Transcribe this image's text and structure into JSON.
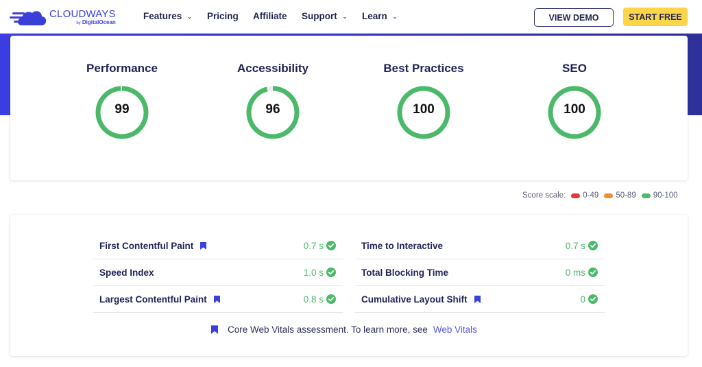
{
  "header": {
    "logo": {
      "name": "CLOUDWAYS",
      "by": "by",
      "sub": "DigitalOcean"
    },
    "nav": [
      {
        "label": "Features",
        "dropdown": true
      },
      {
        "label": "Pricing",
        "dropdown": false
      },
      {
        "label": "Affiliate",
        "dropdown": false
      },
      {
        "label": "Support",
        "dropdown": true
      },
      {
        "label": "Learn",
        "dropdown": true
      }
    ],
    "view_demo": "VIEW DEMO",
    "start_free": "START FREE"
  },
  "colors": {
    "brand": "#3a3fd9",
    "pass": "#4cb96a",
    "average": "#f08c36",
    "fail": "#e53935",
    "cta": "#fcd548"
  },
  "scores": [
    {
      "title": "Performance",
      "value": 99
    },
    {
      "title": "Accessibility",
      "value": 96
    },
    {
      "title": "Best Practices",
      "value": 100
    },
    {
      "title": "SEO",
      "value": 100
    }
  ],
  "score_scale": {
    "label": "Score scale:",
    "ranges": [
      {
        "label": "0-49",
        "color": "#e53935"
      },
      {
        "label": "50-89",
        "color": "#f08c36"
      },
      {
        "label": "90-100",
        "color": "#4cb96a"
      }
    ]
  },
  "metrics": {
    "left": [
      {
        "label": "First Contentful Paint",
        "value": "0.7 s",
        "core_web_vital": true
      },
      {
        "label": "Speed Index",
        "value": "1.0 s",
        "core_web_vital": false
      },
      {
        "label": "Largest Contentful Paint",
        "value": "0.8 s",
        "core_web_vital": true
      }
    ],
    "right": [
      {
        "label": "Time to Interactive",
        "value": "0.7 s",
        "core_web_vital": false
      },
      {
        "label": "Total Blocking Time",
        "value": "0 ms",
        "core_web_vital": false
      },
      {
        "label": "Cumulative Layout Shift",
        "value": "0",
        "core_web_vital": true
      }
    ]
  },
  "footnote": {
    "text": "Core Web Vitals assessment. To learn more, see",
    "link": "Web Vitals"
  }
}
